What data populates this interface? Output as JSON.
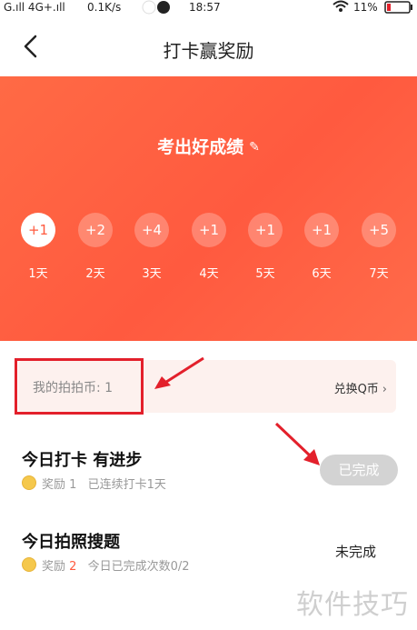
{
  "status_bar": {
    "carrier": "G.ıll 4G+.ıll",
    "speed": "0.1K/s",
    "time": "18:57",
    "battery": "11%"
  },
  "nav": {
    "back_icon": "chevron-left-icon",
    "title": "打卡赢奖励"
  },
  "hero": {
    "title": "考出好成绩",
    "edit_icon": "pencil-icon",
    "days": [
      {
        "reward": "+1",
        "label": "1天",
        "active": true
      },
      {
        "reward": "+2",
        "label": "2天",
        "active": false
      },
      {
        "reward": "+4",
        "label": "3天",
        "active": false
      },
      {
        "reward": "+1",
        "label": "4天",
        "active": false
      },
      {
        "reward": "+1",
        "label": "5天",
        "active": false
      },
      {
        "reward": "+1",
        "label": "6天",
        "active": false
      },
      {
        "reward": "+5",
        "label": "7天",
        "active": false
      }
    ]
  },
  "coins": {
    "label": "我的拍拍币: 1",
    "exchange_label": "兑换Q币",
    "exchange_icon": "chevron-right-icon"
  },
  "tasks": [
    {
      "title": "今日打卡 有进步",
      "reward_label": "奖励",
      "reward_value": "1",
      "detail": "已连续打卡1天",
      "status": "已完成"
    },
    {
      "title": "今日拍照搜题",
      "reward_label": "奖励",
      "reward_value": "2",
      "detail": "今日已完成次数0/2",
      "status": "未完成"
    }
  ],
  "watermark": "软件技巧",
  "colors": {
    "accent": "#ff5a3f",
    "annotation": "#e3202b"
  }
}
